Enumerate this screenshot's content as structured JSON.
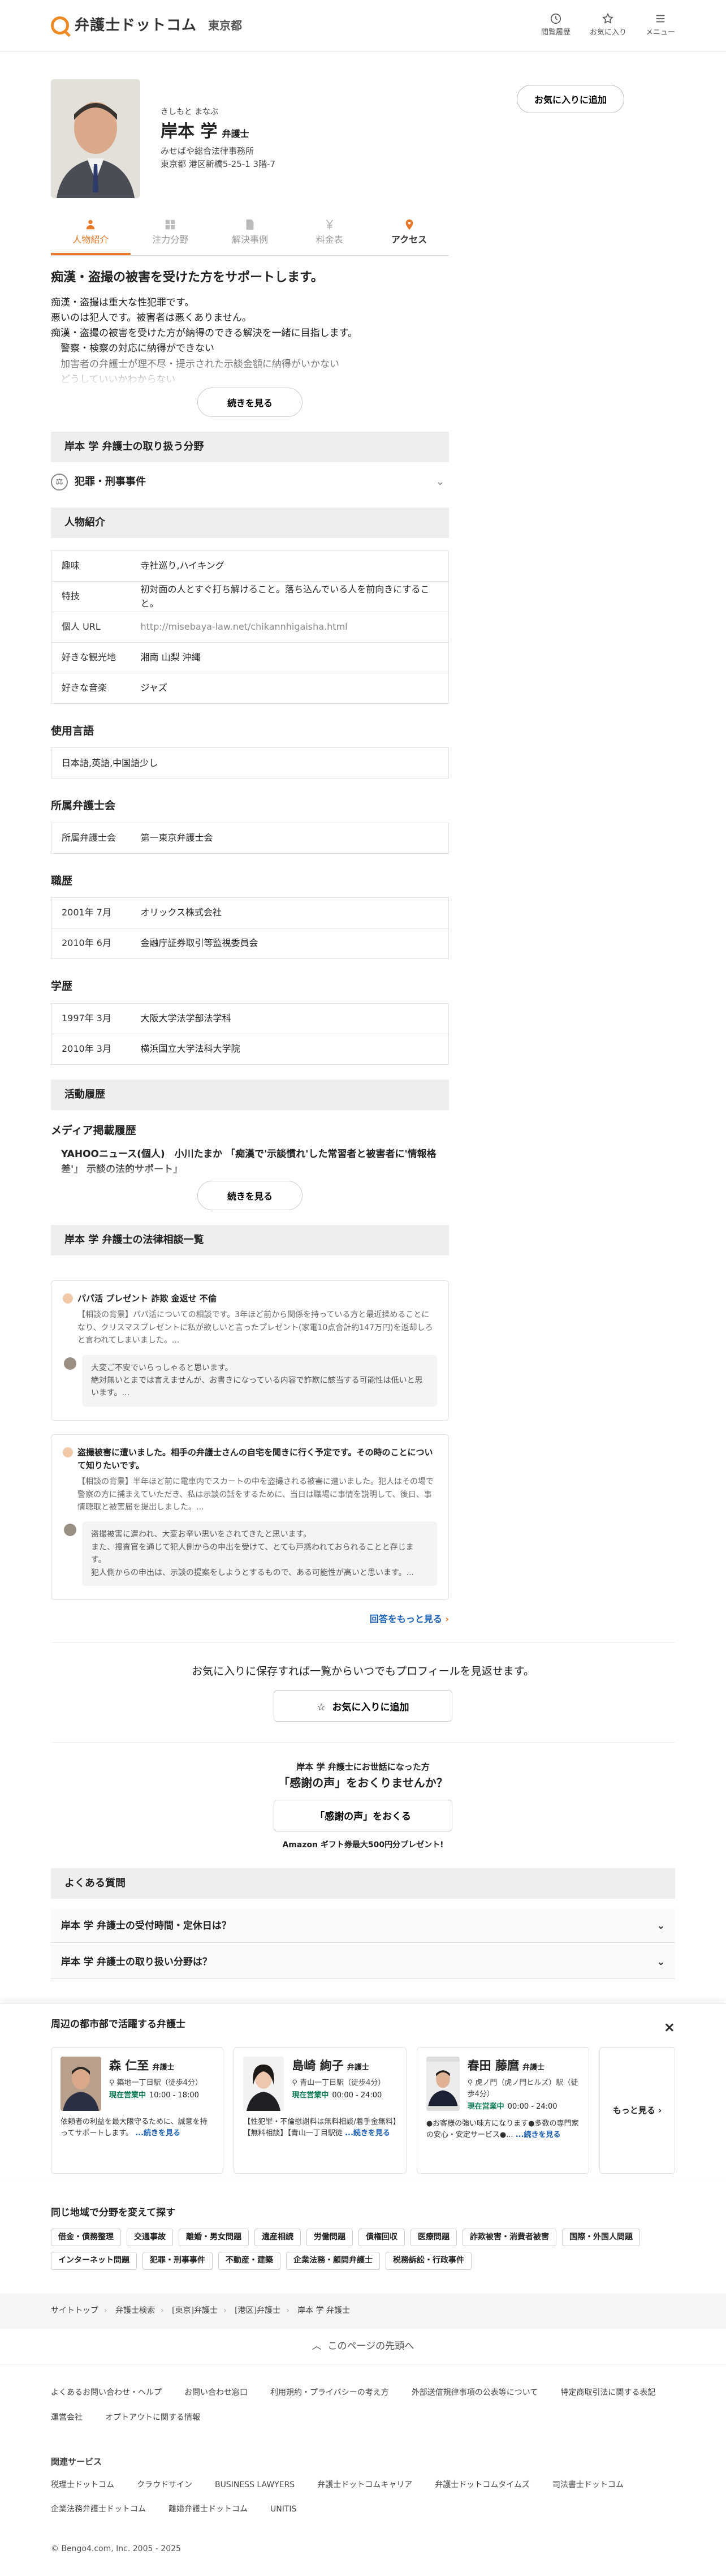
{
  "header": {
    "logo_text": "弁護士ドットコム",
    "region": "東京都",
    "actions": [
      {
        "label": "閲覧履歴",
        "icon": "history-icon"
      },
      {
        "label": "お気に入り",
        "icon": "star-icon"
      },
      {
        "label": "メニュー",
        "icon": "menu-icon"
      }
    ]
  },
  "profile": {
    "kana": "きしもと まなぶ",
    "name": "岸本 学",
    "title": "弁護士",
    "office": "みせばや総合法律事務所",
    "address": "東京都 港区新橋5-25-1 3階-7",
    "fav_button": "お気に入りに追加"
  },
  "tabs": [
    {
      "label": "人物紹介",
      "icon": "person-icon"
    },
    {
      "label": "注力分野",
      "icon": "grid-icon"
    },
    {
      "label": "解決事例",
      "icon": "document-icon"
    },
    {
      "label": "料金表",
      "icon": "yen-icon"
    },
    {
      "label": "アクセス",
      "icon": "map-pin-icon"
    }
  ],
  "lead": {
    "title": "痴漢・盗撮の被害を受けた方をサポートします。",
    "lines": [
      "痴漢・盗撮は重大な性犯罪です。",
      "悪いのは犯人です。被害者は悪くありません。",
      "痴漢・盗撮の被害を受けた方が納得のできる解決を一緒に目指します。",
      "　警察・検察の対応に納得ができない",
      "　加害者の弁護士が理不尽・提示された示談金額に納得がいかない",
      "　どうしていいかわからない"
    ],
    "more_button": "続きを見る"
  },
  "fields": {
    "heading": "岸本 学 弁護士の取り扱う分野",
    "item": "犯罪・刑事事件"
  },
  "intro": {
    "heading": "人物紹介",
    "rows": [
      {
        "k": "趣味",
        "v": "寺社巡り,ハイキング"
      },
      {
        "k": "特技",
        "v": "初対面の人とすぐ打ち解けること。落ち込んでいる人を前向きにすること。"
      },
      {
        "k": "個人 URL",
        "v": "http://misebaya-law.net/chikannhigaisha.html"
      },
      {
        "k": "好きな観光地",
        "v": "湘南 山梨 沖縄"
      },
      {
        "k": "好きな音楽",
        "v": "ジャズ"
      }
    ]
  },
  "languages": {
    "heading": "使用言語",
    "value": "日本語,英語,中国語少し"
  },
  "bar": {
    "heading": "所属弁護士会",
    "k": "所属弁護士会",
    "v": "第一東京弁護士会"
  },
  "career": {
    "heading": "職歴",
    "rows": [
      {
        "k": "2001年 7月",
        "v": "オリックス株式会社"
      },
      {
        "k": "2010年 6月",
        "v": "金融庁証券取引等監視委員会"
      }
    ]
  },
  "education": {
    "heading": "学歴",
    "rows": [
      {
        "k": "1997年 3月",
        "v": "大阪大学法学部法学科"
      },
      {
        "k": "2010年 3月",
        "v": "横浜国立大学法科大学院"
      }
    ]
  },
  "activity": {
    "heading": "活動履歴",
    "media_title": "メディア掲載履歴",
    "media_text": "YAHOOニュース(個人)　小川たまか 「痴漢で'示談慣れ'した常習者と被害者に'情報格差'」 示談の法的サポート」",
    "more_button": "続きを見る"
  },
  "consultations": {
    "heading": "岸本 学 弁護士の法律相談一覧",
    "items": [
      {
        "title": "パパ活 プレゼント 詐欺 金返せ 不倫",
        "body": "【相談の背景】パパ活についての相談です。3年ほど前から関係を持っている方と最近揉めることになり、クリスマスプレゼントに私が欲しいと言ったプレゼント(家電10点合計約147万円)を返却しろと言われてしまいました。...",
        "answer": "大変ご不安でいらっしゃると思います。\n絶対無いとまでは言えませんが、お書きになっている内容で詐欺に該当する可能性は低いと思います。..."
      },
      {
        "title": "盗撮被害に遭いました。相手の弁護士さんの自宅を聞きに行く予定です。その時のことについて知りたいです。",
        "body": "【相談の背景】半年ほど前に電車内でスカートの中を盗撮される被害に遭いました。犯人はその場で警察の方に捕まえていただき、私は示談の話をするために、当日は職場に事情を説明して、後日、事情聴取と被害届を提出しました。...",
        "answer": "盗撮被害に遭われ、大変お辛い思いをされてきたと思います。\nまた、捜査官を通じて犯人側からの申出を受けて、とても戸惑われておられることと存じます。\n犯人側からの申出は、示談の提案をしようとするもので、ある可能性が高いと思います。..."
      }
    ],
    "more_link": "回答をもっと見る"
  },
  "favorite": {
    "lead": "お気に入りに保存すれば一覧からいつでもプロフィールを見返せます。",
    "button": "お気に入りに追加"
  },
  "thanks": {
    "t1": "岸本 学 弁護士にお世話になった方",
    "t2": "「感謝の声」をおくりませんか？",
    "button": "「感謝の声」をおくる",
    "t3": "Amazon ギフト券最大500円分プレゼント!"
  },
  "faq": {
    "heading": "よくある質問",
    "items": [
      "岸本 学 弁護士の受付時間・定休日は？",
      "岸本 学 弁護士の取り扱い分野は？"
    ]
  },
  "nearby": {
    "heading": "周辺の都市部で活躍する弁護士",
    "cards": [
      {
        "name": "森 仁至",
        "title": "弁護士",
        "loc": "築地一丁目駅（徒歩4分）",
        "status": "現在営業中",
        "hours": "10:00 - 18:00",
        "desc": "依頼者の利益を最大限守るために、誠意を持ってサポートします。",
        "more": "...続きを見る"
      },
      {
        "name": "島崎 絢子",
        "title": "弁護士",
        "loc": "青山一丁目駅（徒歩4分）",
        "status": "現在営業中",
        "hours": "00:00 - 24:00",
        "desc": "【性犯罪・不倫慰謝料は無料相談/着手金無料】【無料相談】【青山一丁目駅徒",
        "more": "...続きを見る"
      },
      {
        "name": "春田 藤麿",
        "title": "弁護士",
        "loc": "虎ノ門（虎ノ門ヒルズ）駅（徒歩4分）",
        "status": "現在営業中",
        "hours": "00:00 - 24:00",
        "desc": "●お客様の強い味方になります●多数の専門家の安心・安定サービス●...",
        "more": "...続きを見る"
      }
    ],
    "more_card": "もっと見る",
    "close": "×"
  },
  "area": {
    "heading": "同じ地域で分野を変えて探す",
    "chips": [
      "借金・債務整理",
      "交通事故",
      "離婚・男女問題",
      "遺産相続",
      "労働問題",
      "債権回収",
      "医療問題",
      "詐欺被害・消費者被害",
      "国際・外国人問題",
      "インターネット問題",
      "犯罪・刑事事件",
      "不動産・建築",
      "企業法務・顧問弁護士",
      "税務訴訟・行政事件"
    ]
  },
  "breadcrumb": [
    "サイトトップ",
    "弁護士検索",
    "[東京]弁護士",
    "[港区]弁護士",
    "岸本 学 弁護士"
  ],
  "to_top": "このページの先頭へ",
  "footer": {
    "links": [
      "よくあるお問い合わせ・ヘルプ",
      "お問い合わせ窓口",
      "利用規約・プライバシーの考え方",
      "外部送信規律事項の公表等について",
      "特定商取引法に関する表記",
      "運営会社",
      "オプトアウトに関する情報"
    ],
    "service_title": "関連サービス",
    "services": [
      "税理士ドットコム",
      "クラウドサイン",
      "BUSINESS LAWYERS",
      "弁護士ドットコムキャリア",
      "弁護士ドットコムタイムズ",
      "司法書士ドットコム",
      "企業法務弁護士ドットコム",
      "離婚弁護士ドットコム",
      "UNITIS"
    ],
    "copyright": "© Bengo4.com, Inc. 2005 - 2025"
  }
}
